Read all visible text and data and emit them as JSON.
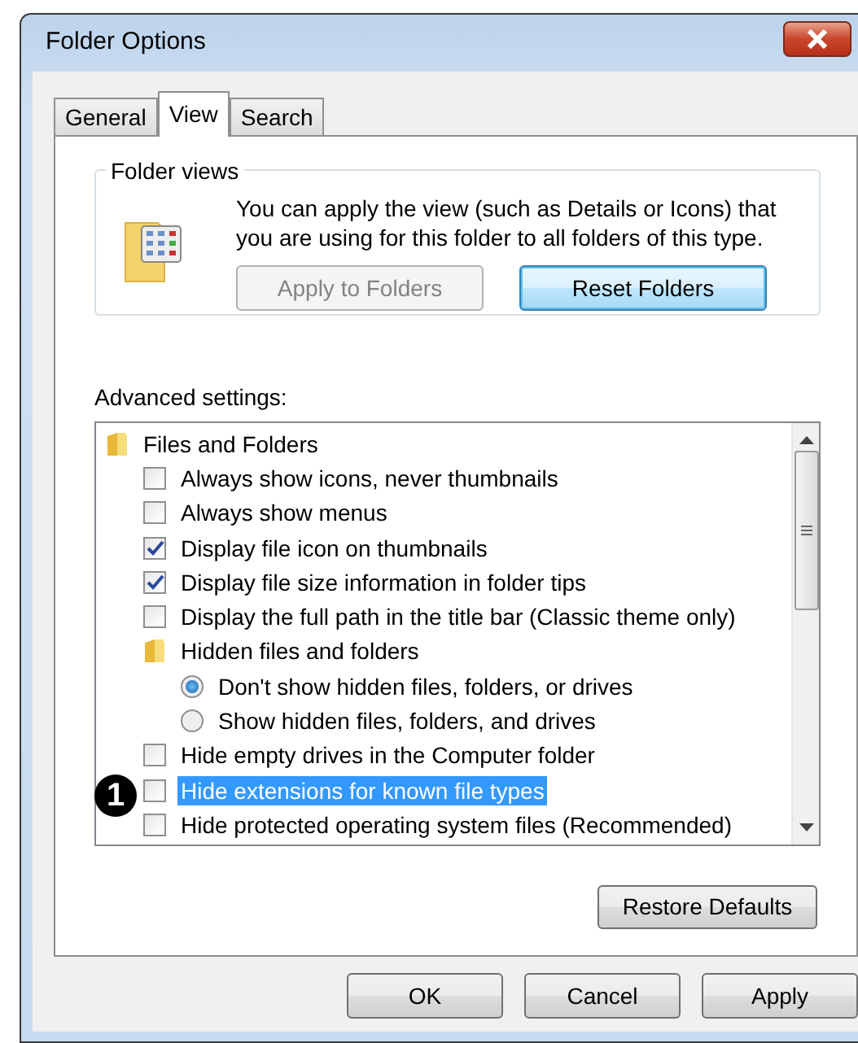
{
  "window": {
    "title": "Folder Options"
  },
  "tabs": [
    {
      "label": "General",
      "selected": false
    },
    {
      "label": "View",
      "selected": true
    },
    {
      "label": "Search",
      "selected": false
    }
  ],
  "folder_views": {
    "legend": "Folder views",
    "description": "You can apply the view (such as Details or Icons) that you are using for this folder to all folders of this type.",
    "buttons": [
      {
        "label": "Apply to Folders",
        "disabled": true,
        "default": false
      },
      {
        "label": "Reset Folders",
        "disabled": false,
        "default": true
      }
    ]
  },
  "advanced_settings": {
    "label": "Advanced settings:",
    "items": [
      {
        "kind": "group",
        "label": "Files and Folders",
        "selected": false,
        "children": [
          {
            "kind": "checkbox",
            "label": "Always show icons, never thumbnails",
            "checked": false,
            "selected": false
          },
          {
            "kind": "checkbox",
            "label": "Always show menus",
            "checked": false,
            "selected": false
          },
          {
            "kind": "checkbox",
            "label": "Display file icon on thumbnails",
            "checked": true,
            "selected": false
          },
          {
            "kind": "checkbox",
            "label": "Display file size information in folder tips",
            "checked": true,
            "selected": false
          },
          {
            "kind": "checkbox",
            "label": "Display the full path in the title bar (Classic theme only)",
            "checked": false,
            "selected": false
          },
          {
            "kind": "group",
            "label": "Hidden files and folders",
            "selected": false,
            "children": [
              {
                "kind": "radio",
                "label": "Don't show hidden files, folders, or drives",
                "checked": true,
                "selected": false
              },
              {
                "kind": "radio",
                "label": "Show hidden files, folders, and drives",
                "checked": false,
                "selected": false
              }
            ]
          },
          {
            "kind": "checkbox",
            "label": "Hide empty drives in the Computer folder",
            "checked": false,
            "selected": false
          },
          {
            "kind": "checkbox",
            "label": "Hide extensions for known file types",
            "checked": false,
            "selected": true
          },
          {
            "kind": "checkbox",
            "label": "Hide protected operating system files (Recommended)",
            "checked": false,
            "selected": false
          }
        ]
      }
    ]
  },
  "restore_button": "Restore Defaults",
  "callout": "1",
  "dialog_buttons": [
    "OK",
    "Cancel",
    "Apply"
  ]
}
